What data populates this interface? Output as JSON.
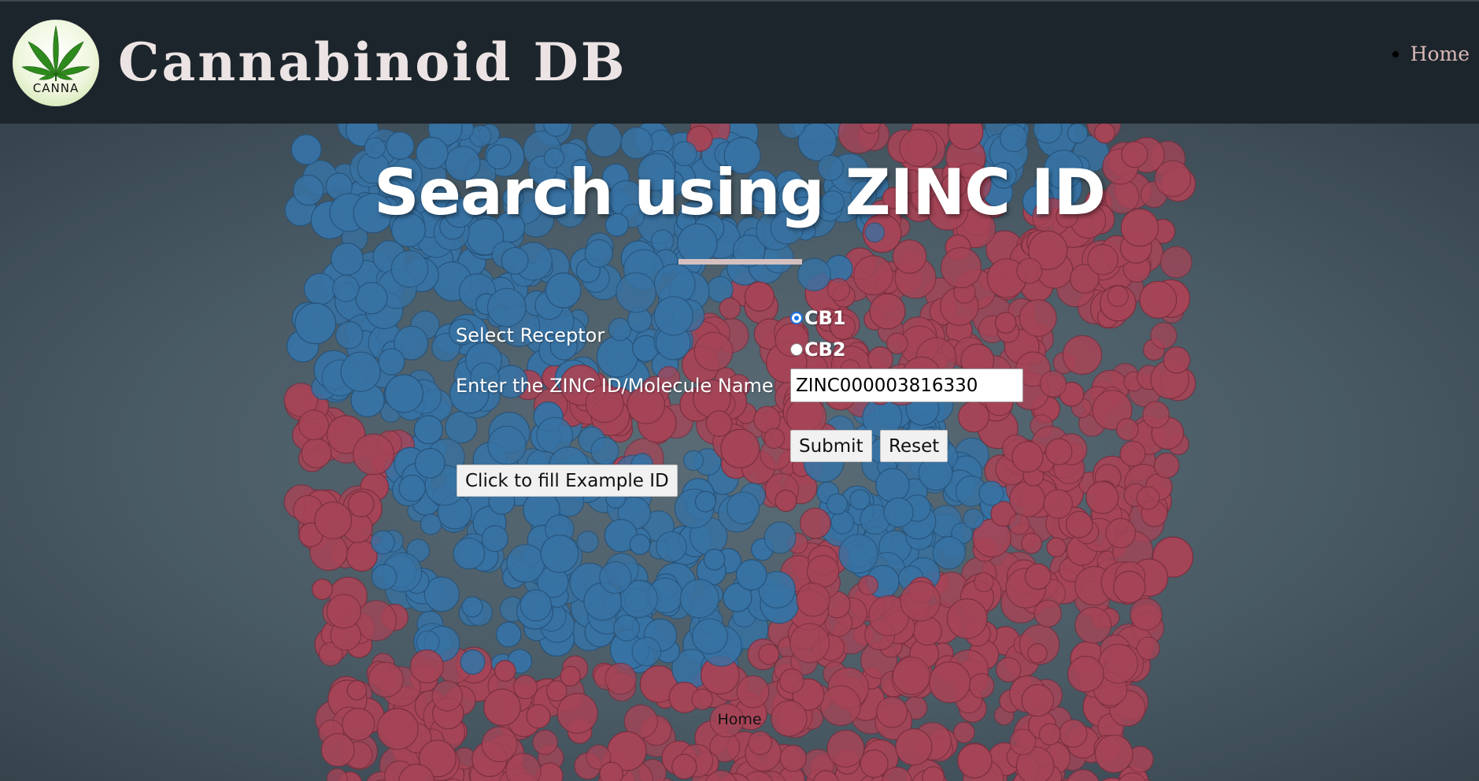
{
  "header": {
    "logo_text": "CANNA",
    "site_title": "Cannabinoid DB",
    "nav": [
      {
        "label": "Home"
      }
    ]
  },
  "main": {
    "title": "Search using ZINC ID",
    "receptor_label": "Select Receptor",
    "receptor_options": [
      {
        "label": "CB1",
        "checked": true
      },
      {
        "label": "CB2",
        "checked": false
      }
    ],
    "zinc_label": "Enter the ZINC ID/Molecule Name",
    "zinc_value": "ZINC000003816330",
    "submit_label": "Submit",
    "reset_label": "Reset",
    "example_label": "Click to fill Example ID"
  },
  "footer": {
    "home_label": "Home"
  },
  "colors": {
    "header_bg": "#1d252c",
    "title_text": "#ece4e4",
    "nav_link": "#d9b9b9",
    "protein_red": "#c64e62",
    "protein_blue": "#3f86c0",
    "background": "#5c6e78"
  },
  "icons": {
    "logo": "cannabis-leaf-icon"
  }
}
